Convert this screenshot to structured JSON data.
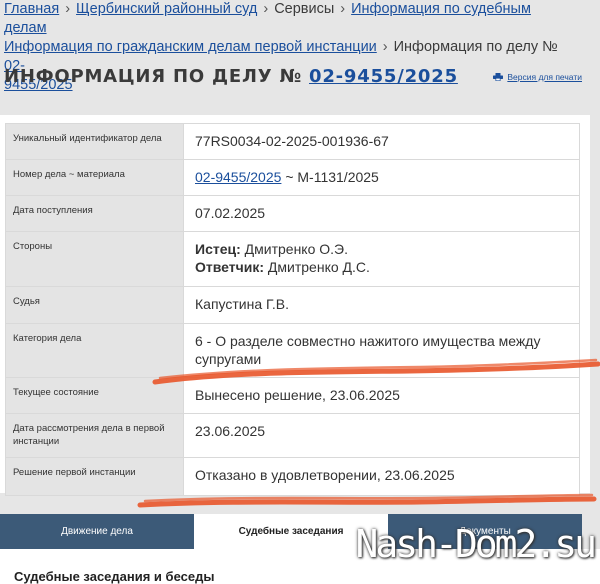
{
  "breadcrumb": {
    "items": [
      "Главная",
      "Щербинский районный суд",
      "Сервисы",
      "Информация по судебным делам",
      "Информация по гражданским делам первой инстанции"
    ],
    "current": "Информация по делу № 02-9455/2025",
    "separator": "›"
  },
  "header": {
    "title_prefix": "ИНФОРМАЦИЯ ПО ДЕЛУ №",
    "case_number": "02-9455/2025",
    "print_link": "Версия для печати"
  },
  "case": {
    "uid_label": "Уникальный идентификатор дела",
    "uid": "77RS0034-02-2025-001936-67",
    "number_label": "Номер дела ~ материала",
    "number": "02-9455/2025",
    "material": "~ М-1131/2025",
    "received_label": "Дата поступления",
    "received": "07.02.2025",
    "parties_label": "Стороны",
    "plaintiff_label": "Истец:",
    "plaintiff": "Дмитренко О.Э.",
    "defendant_label": "Ответчик:",
    "defendant": "Дмитренко Д.С.",
    "judge_label": "Судья",
    "judge": "Капустина Г.В.",
    "category_label": "Категория дела",
    "category": "6 - О разделе совместно нажитого имущества между супругами",
    "state_label": "Текущее состояние",
    "state": "Вынесено решение, 23.06.2025",
    "review_date_label": "Дата рассмотрения дела в первой инстанции",
    "review_date": "23.06.2025",
    "decision_label": "Решение первой инстанции",
    "decision": "Отказано в удовлетворении, 23.06.2025"
  },
  "tabs": [
    {
      "label": "Движение дела",
      "active": false
    },
    {
      "label": "Судебные заседания",
      "active": true
    },
    {
      "label": "Документы",
      "active": false
    }
  ],
  "section": {
    "title": "Судебные заседания и беседы"
  },
  "watermark": "Nash-Dom2.su",
  "colors": {
    "link": "#1b4f9c",
    "tab_bg": "#3c5a78",
    "scribble": "#e8552a"
  }
}
